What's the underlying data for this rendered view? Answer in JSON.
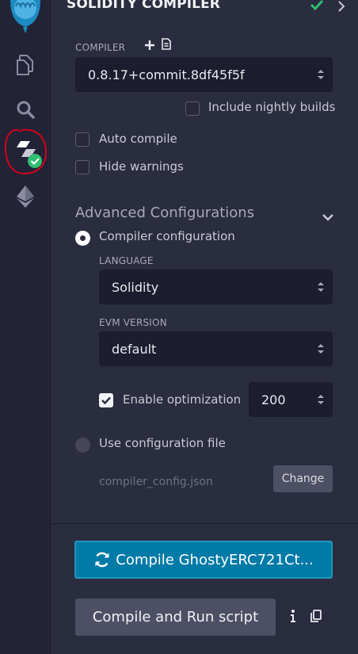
{
  "icons": {
    "logo": "remix-logo-icon",
    "file_explorer": "file-explorer-icon",
    "search": "search-icon",
    "compiler": "solidity-compiler-icon",
    "deploy": "deploy-run-icon"
  },
  "header": {
    "title": "SOLIDITY COMPILER",
    "status_icon": "check-icon",
    "chevron_icon": "chevron-right-icon"
  },
  "compiler": {
    "label": "COMPILER",
    "add_icon": "plus-icon",
    "file_icon": "file-icon",
    "version": "0.8.17+commit.8df45f5f",
    "include_nightly_label": "Include nightly builds",
    "include_nightly_checked": false
  },
  "options": {
    "auto_compile_label": "Auto compile",
    "auto_compile_checked": false,
    "hide_warnings_label": "Hide warnings",
    "hide_warnings_checked": false
  },
  "advanced": {
    "title": "Advanced Configurations",
    "compiler_config_label": "Compiler configuration",
    "compiler_config_selected": true,
    "language_label": "LANGUAGE",
    "language_value": "Solidity",
    "evm_label": "EVM VERSION",
    "evm_value": "default",
    "optimization_label": "Enable optimization",
    "optimization_checked": true,
    "optimization_runs": "200",
    "use_config_file_label": "Use configuration file",
    "use_config_file_selected": false,
    "config_file_path": "compiler_config.json",
    "change_button": "Change"
  },
  "actions": {
    "compile_button": "Compile GhostyERC721Ct...",
    "compile_icon": "refresh-icon",
    "run_script_button": "Compile and Run script",
    "info_icon": "info-icon",
    "copy_icon": "copy-icon"
  },
  "colors": {
    "accent": "#007aa6",
    "success": "#2fbf71",
    "panel_bg": "#2a2c3f",
    "icon_bar_bg": "#222336",
    "annotation": "#d0021b"
  }
}
